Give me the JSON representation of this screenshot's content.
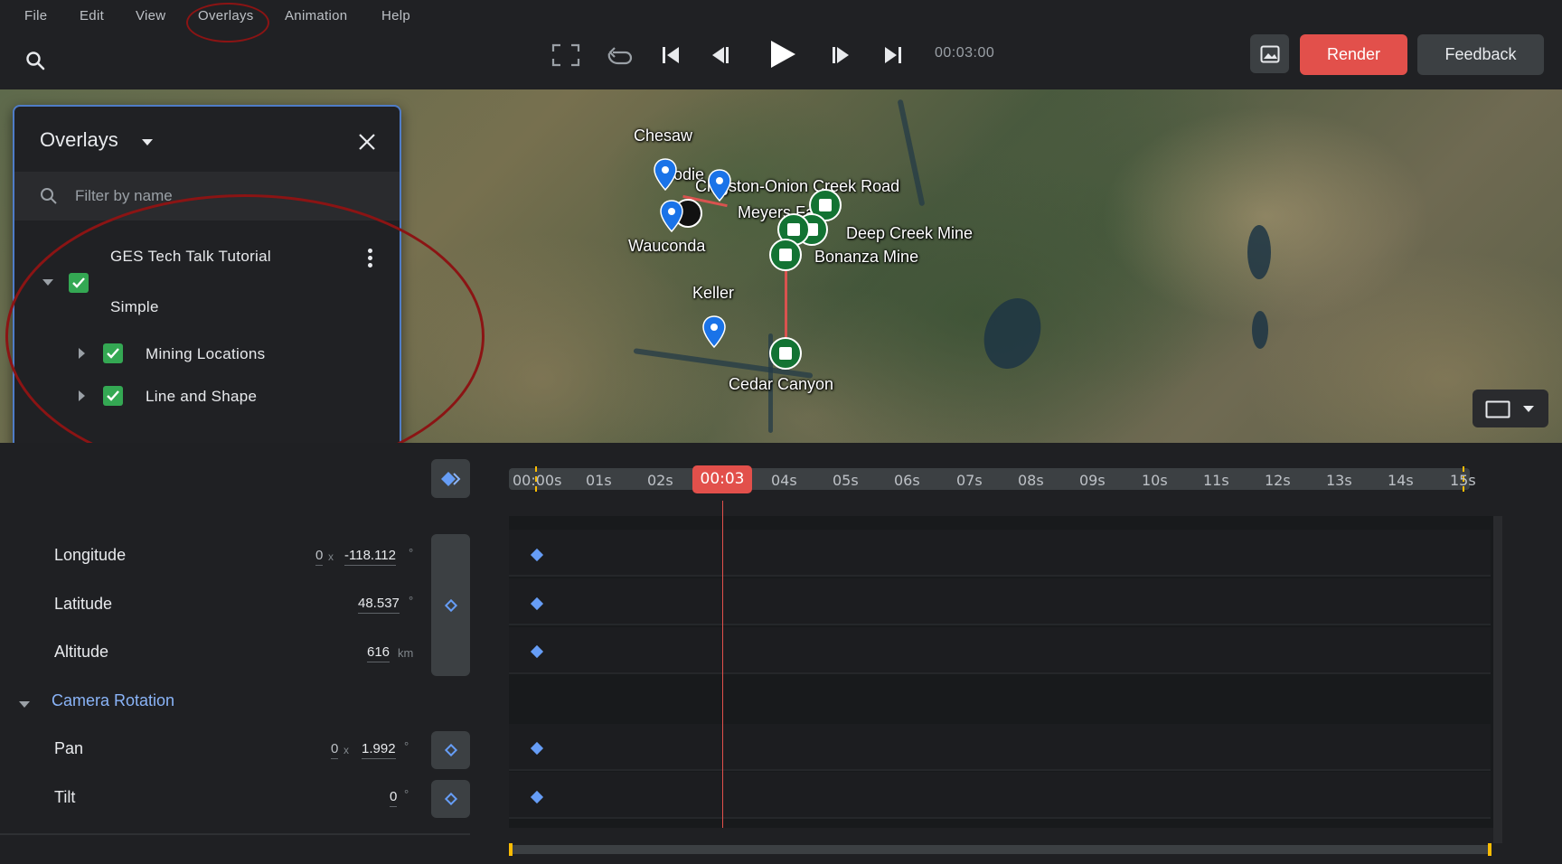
{
  "menu": [
    "File",
    "Edit",
    "View",
    "Overlays",
    "Animation",
    "Help"
  ],
  "transport": {
    "time": "00:03:00",
    "icons": [
      "fullscreen-icon",
      "loop-icon",
      "skip-to-start-icon",
      "step-back-icon",
      "play-icon",
      "step-forward-icon",
      "skip-to-end-icon"
    ]
  },
  "toolbar": {
    "render_label": "Render",
    "feedback_label": "Feedback"
  },
  "map": {
    "labels": [
      "Chesaw",
      "Bodie",
      "Clugston-Onion Creek Road",
      "Meyers Falls",
      "Deep Creek Mine",
      "Wauconda",
      "Bonanza Mine",
      "Keller",
      "Cedar Canyon"
    ]
  },
  "overlays_panel": {
    "title": "Overlays",
    "filter_placeholder": "Filter by name",
    "project_line1": "GES Tech Talk Tutorial",
    "project_line2": "Simple",
    "children": [
      "Mining Locations",
      "Line and Shape"
    ]
  },
  "timeline": {
    "ticks": [
      "00:00s",
      "01s",
      "02s",
      "00:03",
      "04s",
      "05s",
      "06s",
      "07s",
      "08s",
      "09s",
      "10s",
      "11s",
      "12s",
      "13s",
      "14s",
      "15s"
    ],
    "current_index": 3
  },
  "properties": {
    "longitude": {
      "label": "Longitude",
      "zero": "0",
      "x": "x",
      "value": "-118.112",
      "unit": "°"
    },
    "latitude": {
      "label": "Latitude",
      "value": "48.537",
      "unit": "°"
    },
    "altitude": {
      "label": "Altitude",
      "value": "616",
      "unit": "km"
    },
    "camera_rotation": {
      "label": "Camera Rotation"
    },
    "pan": {
      "label": "Pan",
      "zero": "0",
      "x": "x",
      "value": "1.992",
      "unit": "°"
    },
    "tilt": {
      "label": "Tilt",
      "value": "0",
      "unit": "°"
    }
  },
  "colors": {
    "accent_red": "#e2504b",
    "keyframe_blue": "#669df6",
    "check_green": "#34a853",
    "annotation_red": "#8b1414"
  }
}
